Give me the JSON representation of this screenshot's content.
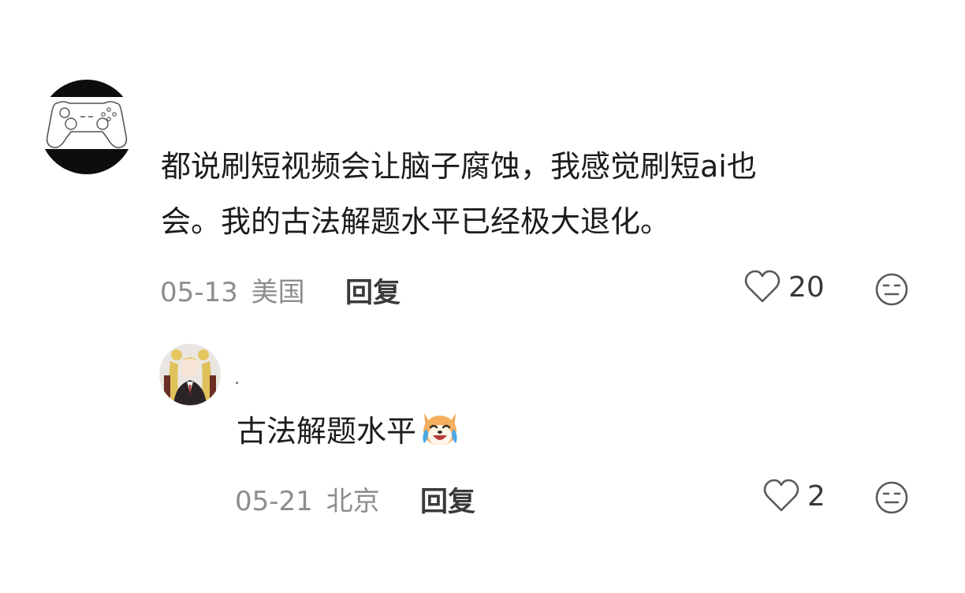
{
  "comments": [
    {
      "avatar_icon": "gamepad-avatar",
      "text": "都说刷短视频会让脑子腐蚀，我感觉刷短ai也\n会。我的古法解题水平已经极大退化。",
      "date": "05-13",
      "location": "美国",
      "reply_label": "回复",
      "like_count": "20",
      "like_icon": "heart-outline-icon",
      "dislike_icon": "meh-face-icon"
    },
    {
      "avatar_icon": "anime-character-avatar",
      "text": "古法解题水平",
      "emoji": "crying-laughing-dog-emoji",
      "date": "05-21",
      "location": "北京",
      "reply_label": "回复",
      "like_count": "2",
      "like_icon": "heart-outline-icon",
      "dislike_icon": "meh-face-icon"
    }
  ],
  "colors": {
    "text": "#1c1c1c",
    "meta": "#8d8d8d",
    "icon": "#5a5a5a"
  }
}
